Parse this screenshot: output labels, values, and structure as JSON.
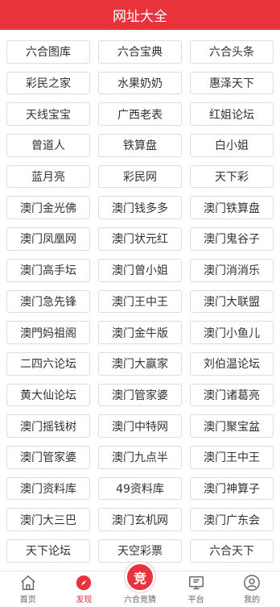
{
  "header": {
    "title": "网址大全"
  },
  "sites": [
    "六合图库",
    "六合宝典",
    "六合头条",
    "彩民之家",
    "水果奶奶",
    "惠泽天下",
    "天线宝宝",
    "广西老表",
    "红姐论坛",
    "曾道人",
    "铁算盘",
    "白小姐",
    "蓝月亮",
    "彩民网",
    "天下彩",
    "澳门金光佛",
    "澳门钱多多",
    "澳门铁算盘",
    "澳门凤凰网",
    "澳门状元红",
    "澳门鬼谷子",
    "澳门高手坛",
    "澳门曾小姐",
    "澳门消消乐",
    "澳门急先锋",
    "澳门王中王",
    "澳门大联盟",
    "澳門妈祖阁",
    "澳门金牛版",
    "澳门小鱼儿",
    "二四六论坛",
    "澳门大赢家",
    "刘伯温论坛",
    "黄大仙论坛",
    "澳门管家婆",
    "澳门诸葛亮",
    "澳门摇钱树",
    "澳门中特网",
    "澳门聚宝盆",
    "澳门管家婆",
    "澳门九点半",
    "澳门王中王",
    "澳门资料库",
    "49资料库",
    "澳门神算子",
    "澳门大三巴",
    "澳门玄机网",
    "澳门广东会",
    "天下论坛",
    "天空彩票",
    "六合天下"
  ],
  "tabbar": {
    "home": "首页",
    "discover": "发现",
    "center": "六合竞猜",
    "center_badge": "竞",
    "platform": "平台",
    "mine": "我的"
  },
  "colors": {
    "accent": "#e8323c",
    "border": "#dcdcdc"
  }
}
